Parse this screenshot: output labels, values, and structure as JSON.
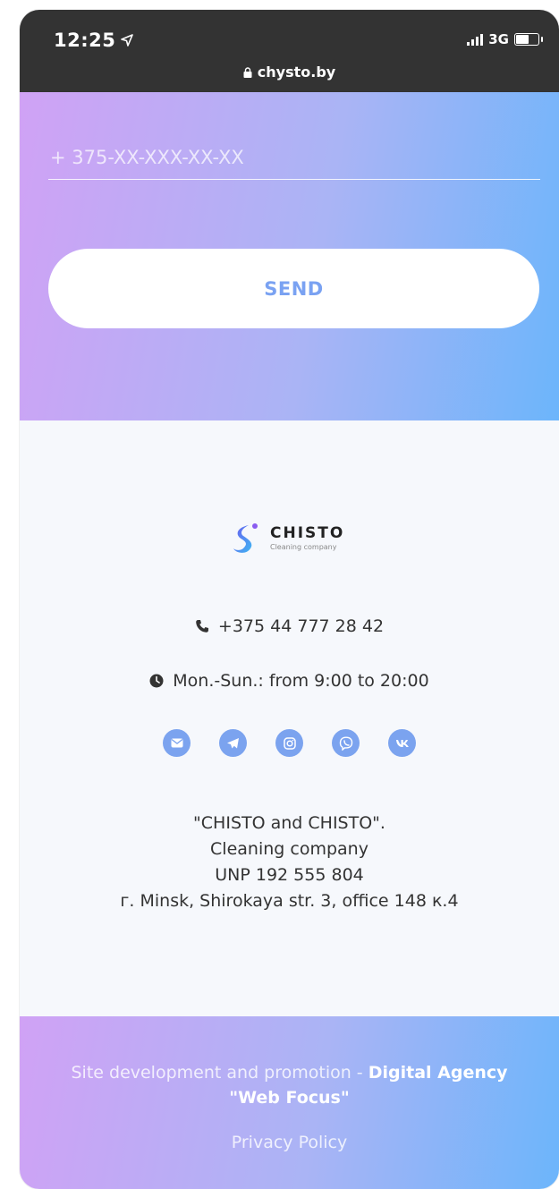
{
  "status_bar": {
    "time": "12:25",
    "network": "3G",
    "url": "chysto.by"
  },
  "form": {
    "phone_placeholder": "+ 375-XX-XXX-XX-XX",
    "send_label": "SEND"
  },
  "footer": {
    "logo_name": "CHISTO",
    "logo_sub": "Cleaning company",
    "phone": "+375 44 777 28 42",
    "hours": "Mon.-Sun.: from 9:00 to 20:00",
    "socials": [
      "mail-icon",
      "telegram-icon",
      "instagram-icon",
      "viber-icon",
      "vk-icon"
    ],
    "address_lines": [
      "\"CHISTO and CHISTO\".",
      "Cleaning company",
      "UNP 192 555 804",
      "г. Minsk, Shirokaya str. 3, office 148 к.4"
    ]
  },
  "bottom": {
    "credit_prefix": "Site development and promotion - ",
    "credit_agency": "Digital Agency \"Web Focus\"",
    "privacy": "Privacy Policy"
  },
  "colors": {
    "accent": "#7aa2f2",
    "gradient_start": "#d0a2f5",
    "gradient_end": "#6cb5fb",
    "status_bar": "#333333"
  }
}
